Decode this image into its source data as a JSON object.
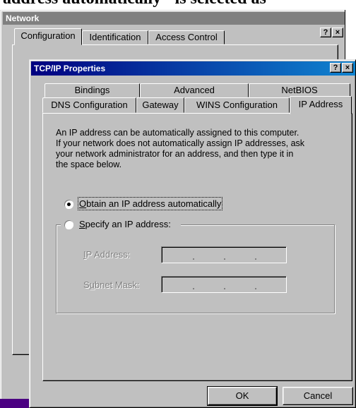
{
  "caption": {
    "text": "address automatically\" is selected as"
  },
  "network_window": {
    "title": "Network",
    "help_glyph": "?",
    "close_glyph": "×",
    "tabs": [
      "Configuration",
      "Identification",
      "Access Control"
    ]
  },
  "tcpip_dialog": {
    "title": "TCP/IP Properties",
    "help_glyph": "?",
    "close_glyph": "×",
    "tabs_back": [
      "Bindings",
      "Advanced",
      "NetBIOS"
    ],
    "tabs_front": [
      "DNS Configuration",
      "Gateway",
      "WINS Configuration",
      "IP Address"
    ],
    "description": [
      "An IP address can be automatically assigned to this computer.",
      "If your network does not automatically assign IP addresses, ask",
      "your network administrator for an address, and then type it in",
      "the space below."
    ],
    "radio_auto": {
      "mnemonic": "O",
      "rest": "btain an IP address automatically",
      "selected": true
    },
    "radio_specify": {
      "mnemonic": "S",
      "rest": "pecify an IP address:",
      "selected": false
    },
    "ip_address": {
      "mnemonic": "I",
      "rest": "P Address:"
    },
    "subnet_mask": {
      "pre": "S",
      "mnemonic": "u",
      "rest": "bnet Mask:"
    },
    "ok_label": "OK",
    "cancel_label": "Cancel"
  }
}
